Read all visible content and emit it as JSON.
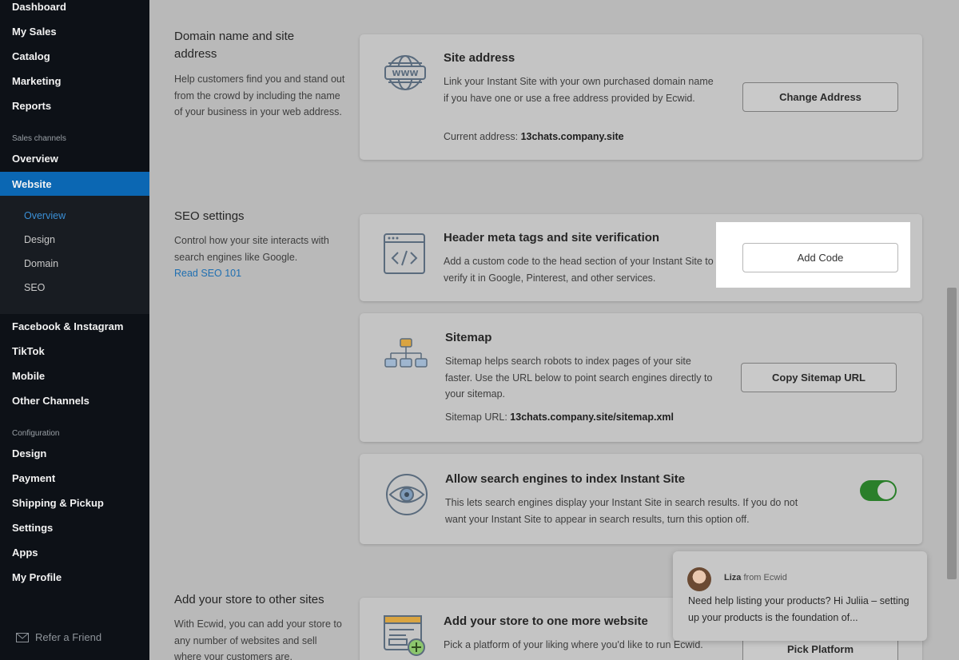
{
  "sidebar": {
    "top_items": [
      "Dashboard",
      "My Sales",
      "Catalog",
      "Marketing",
      "Reports"
    ],
    "sales_channels_label": "Sales channels",
    "overview": "Overview",
    "website": "Website",
    "website_sub": [
      "Overview",
      "Design",
      "Domain",
      "SEO"
    ],
    "channels": [
      "Facebook & Instagram",
      "TikTok",
      "Mobile",
      "Other Channels"
    ],
    "configuration_label": "Configuration",
    "config_items": [
      "Design",
      "Payment",
      "Shipping & Pickup",
      "Settings",
      "Apps",
      "My Profile"
    ],
    "refer": "Refer a Friend"
  },
  "domain_section": {
    "title": "Domain name and site address",
    "desc": "Help customers find you and stand out from the crowd by including the name of your business in your web address.",
    "card": {
      "title": "Site address",
      "text": "Link your Instant Site with your own purchased domain name if you have one or use a free address provided by Ecwid.",
      "current_label": "Current address:",
      "current_value": "13chats.company.site",
      "button": "Change Address"
    }
  },
  "seo_section": {
    "title": "SEO settings",
    "desc": "Control how your site interacts with search engines like Google.",
    "link": "Read SEO 101",
    "meta_card": {
      "title": "Header meta tags and site verification",
      "text": "Add a custom code to the head section of your Instant Site to verify it in Google, Pinterest, and other services.",
      "button": "Add Code"
    },
    "sitemap_card": {
      "title": "Sitemap",
      "text": "Sitemap helps search robots to index pages of your site faster. Use the URL below to point search engines directly to your sitemap.",
      "url_label": "Sitemap URL:",
      "url_value": "13chats.company.site/sitemap.xml",
      "button": "Copy Sitemap URL"
    },
    "index_card": {
      "title": "Allow search engines to index Instant Site",
      "text": "This lets search engines display your Instant Site in search results. If you do not want your Instant Site to appear in search results, turn this option off.",
      "enabled": true
    }
  },
  "store_section": {
    "title": "Add your store to other sites",
    "desc": "With Ecwid, you can add your store to any number of websites and sell where your customers are.",
    "card": {
      "title": "Add your store to one more website",
      "text": "Pick a platform of your liking where you'd like to run Ecwid.",
      "button": "Pick Platform"
    }
  },
  "chat": {
    "name": "Liza",
    "from": "from Ecwid",
    "message": "Need help listing your products? Hi Juliia – setting up your products is the foundation of..."
  },
  "colors": {
    "sidebar_bg": "#0d1117",
    "active": "#0b67b3",
    "toggle_on": "#2a7f2a",
    "link": "#1f6fb1"
  }
}
